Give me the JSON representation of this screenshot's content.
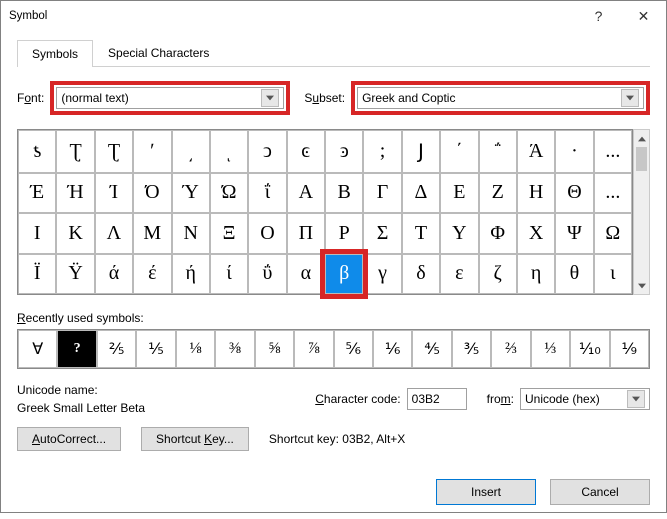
{
  "title": "Symbol",
  "tabs": {
    "symbols": "Symbols",
    "special": "Special Characters"
  },
  "font": {
    "label_pre": "F",
    "label_ul": "o",
    "label_post": "nt:",
    "value": "(normal text)"
  },
  "subset": {
    "label_pre": "S",
    "label_ul": "u",
    "label_post": "bset:",
    "value": "Greek and Coptic"
  },
  "grid_rows": [
    [
      "ƾ",
      "Ʈ",
      "Ʈ",
      "ʹ",
      "͵",
      "ͺ",
      "ͻ",
      "ͼ",
      "ͽ",
      ";",
      "Ϳ",
      "΄",
      "΅",
      "Ά",
      "·"
    ],
    [
      "Έ",
      "Ή",
      "Ί",
      "Ό",
      "Ύ",
      "Ώ",
      "ΐ",
      "Α",
      "Β",
      "Γ",
      "Δ",
      "Ε",
      "Ζ",
      "Η",
      "Θ"
    ],
    [
      "Ι",
      "Κ",
      "Λ",
      "Μ",
      "Ν",
      "Ξ",
      "Ο",
      "Π",
      "Ρ",
      "Σ",
      "Τ",
      "Υ",
      "Φ",
      "Χ",
      "Ψ",
      "Ω"
    ],
    [
      "Ϊ",
      "Ϋ",
      "ά",
      "έ",
      "ή",
      "ί",
      "ΰ",
      "α",
      "β",
      "γ",
      "δ",
      "ε",
      "ζ",
      "η",
      "θ",
      "ι"
    ]
  ],
  "ellipsis": "...",
  "selected_index": 40,
  "recent_label_pre": "",
  "recent_label_ul": "R",
  "recent_label_post": "ecently used symbols:",
  "recent": [
    "∀",
    "?",
    "⅖",
    "⅕",
    "⅛",
    "⅜",
    "⅝",
    "⅞",
    "⅚",
    "⅙",
    "⅘",
    "⅗",
    "⅔",
    "⅓",
    "⅒",
    "⅑"
  ],
  "unicode_name_label": "Unicode name:",
  "unicode_name_value": "Greek Small Letter Beta",
  "charcode": {
    "label_ul": "C",
    "label_post": "haracter code:",
    "value": "03B2"
  },
  "from": {
    "label_pre": "fro",
    "label_ul": "m",
    "label_post": ":",
    "value": "Unicode (hex)"
  },
  "buttons": {
    "autocorrect_ul": "A",
    "autocorrect_post": "utoCorrect...",
    "shortcut_pre": "Shortcut ",
    "shortcut_ul": "K",
    "shortcut_post": "ey..."
  },
  "shortcut_info_label": "Shortcut key:",
  "shortcut_info_value": "03B2, Alt+X",
  "footer": {
    "insert": "Insert",
    "cancel": "Cancel"
  }
}
